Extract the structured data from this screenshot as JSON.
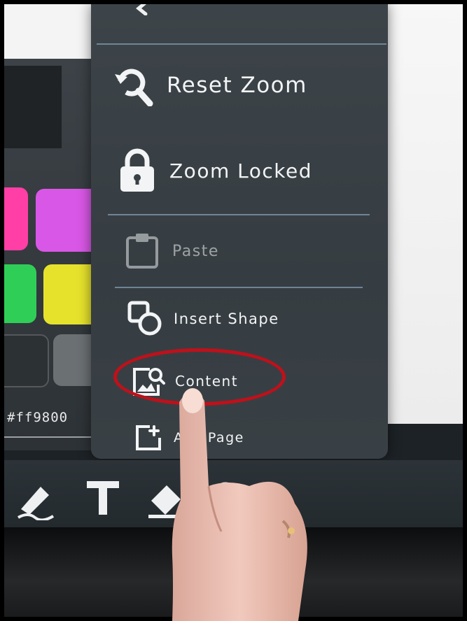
{
  "menu": {
    "items": [
      {
        "label": "Reset Zoom",
        "icon": "reset-zoom-icon",
        "enabled": true
      },
      {
        "label": "Zoom Locked",
        "icon": "lock-icon",
        "enabled": true
      },
      {
        "label": "Paste",
        "icon": "clipboard-icon",
        "enabled": false
      },
      {
        "label": "Insert Shape",
        "icon": "shapes-icon",
        "enabled": true
      },
      {
        "label": "Content",
        "icon": "content-image-icon",
        "enabled": true,
        "highlighted": true
      },
      {
        "label": "Add Page",
        "icon": "add-page-icon",
        "enabled": true
      }
    ]
  },
  "palette": {
    "hex_value": "#ff9800",
    "swatches": [
      "#ff3fa6",
      "#d957e6",
      "#2fcf57",
      "#e6e22c",
      "#2c3134",
      "#6b7073"
    ]
  },
  "toolbar": {
    "tools": [
      "highlighter-icon",
      "text-icon",
      "eraser-icon",
      "lasso-icon"
    ]
  },
  "colors": {
    "menu_bg": "#3a4146",
    "divider": "#7d96ad",
    "highlight_ring": "#c0101a",
    "canvas": "#f4f4f4"
  }
}
